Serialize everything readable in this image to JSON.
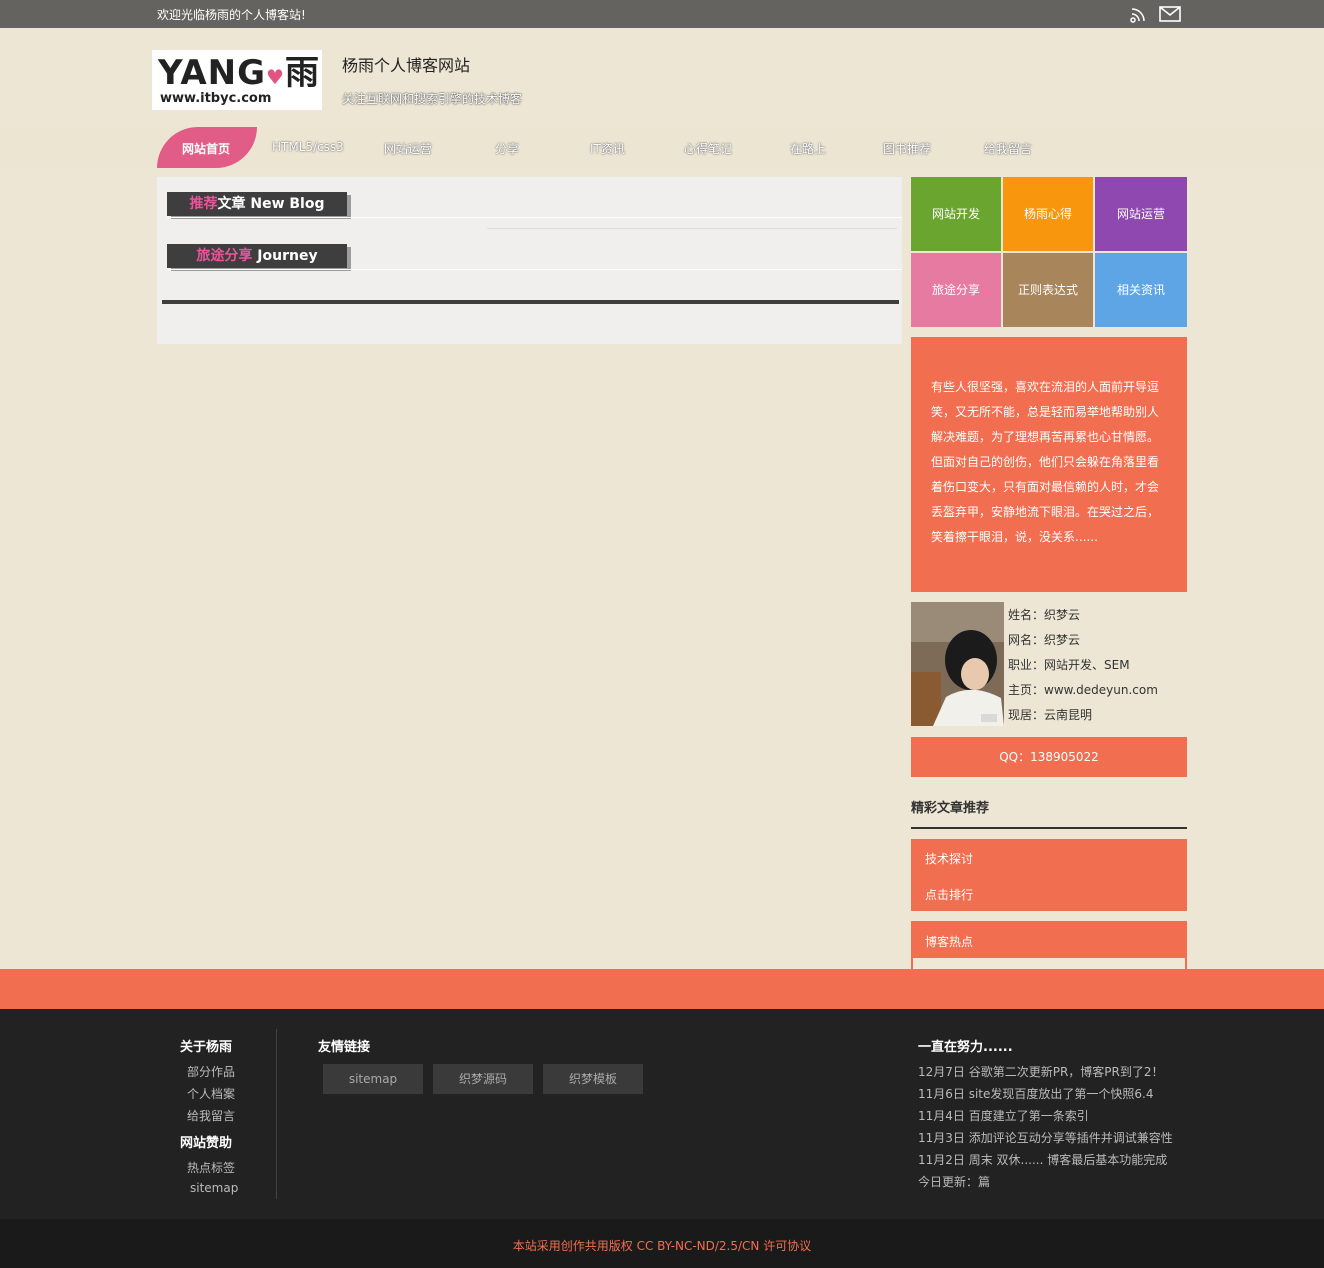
{
  "topbar": {
    "welcome": "欢迎光临杨雨的个人博客站!",
    "icons": [
      "rss-icon",
      "mail-icon"
    ]
  },
  "header": {
    "logo_main": "YANG",
    "logo_char": "雨",
    "logo_url": "www.itbyc.com",
    "title": "杨雨个人博客网站",
    "subtitle": "关注互联网和搜索引擎的技术博客"
  },
  "nav": {
    "items": [
      "网站首页",
      "HTML5/css3",
      "网站运营",
      "分享",
      "IT资讯",
      "心得笔记",
      "在路上",
      "图书推荐",
      "给我留言"
    ]
  },
  "main": {
    "sections": [
      {
        "title_highlight": "推荐",
        "title_rest": "文章 New Blog"
      },
      {
        "title_highlight": "旅途分享",
        "title_rest": " Journey"
      }
    ]
  },
  "sidebar": {
    "tiles": [
      {
        "label": "网站开发",
        "color": "#6aa530"
      },
      {
        "label": "杨雨心得",
        "color": "#f8960e"
      },
      {
        "label": "网站运营",
        "color": "#8e48b0"
      },
      {
        "label": "旅途分享",
        "color": "#e77aa0"
      },
      {
        "label": "正则表达式",
        "color": "#a8855a"
      },
      {
        "label": "相关资讯",
        "color": "#5ea5e6"
      }
    ],
    "quote": "有些人很坚强，喜欢在流泪的人面前开导逗笑，又无所不能，总是轻而易举地帮助别人解决难题，为了理想再苦再累也心甘情愿。但面对自己的创伤，他们只会躲在角落里看着伤口变大，只有面对最信赖的人时，才会丢盔弃甲，安静地流下眼泪。在哭过之后，笑着擦干眼泪，说，没关系......",
    "profile": {
      "name": "姓名：织梦云",
      "nickname": "网名：织梦云",
      "job": "职业：网站开发、SEM",
      "homepage": "主页：www.dedeyun.com",
      "location": "现居：云南昆明"
    },
    "qq": "QQ：138905022",
    "recommend_title": "精彩文章推荐",
    "recommend_tabs": [
      "技术探讨",
      "点击排行"
    ],
    "hot_title": "博客热点"
  },
  "footer": {
    "about_title": "关于杨雨",
    "about_links": [
      "部分作品",
      "个人档案",
      "给我留言"
    ],
    "sponsor_title": "网站赞助",
    "sponsor_links": [
      "热点标签",
      "sitemap"
    ],
    "friends_title": "友情链接",
    "friends": [
      "sitemap",
      "织梦源码",
      "织梦模板"
    ],
    "news_title": "一直在努力......",
    "news": [
      "12月7日 谷歌第二次更新PR，博客PR到了2！",
      "11月6日 site发现百度放出了第一个快照6.4",
      "11月4日 百度建立了第一条索引",
      "11月3日 添加评论互动分享等插件并调试兼容性",
      "11月2日 周末 双休...... 博客最后基本功能完成",
      "今日更新：篇"
    ],
    "copyright": "本站采用创作共用版权 CC BY-NC-ND/2.5/CN 许可协议"
  },
  "colors": {
    "accent": "#f26e50",
    "nav_active": "#e15c86",
    "background": "#ede6d4"
  }
}
